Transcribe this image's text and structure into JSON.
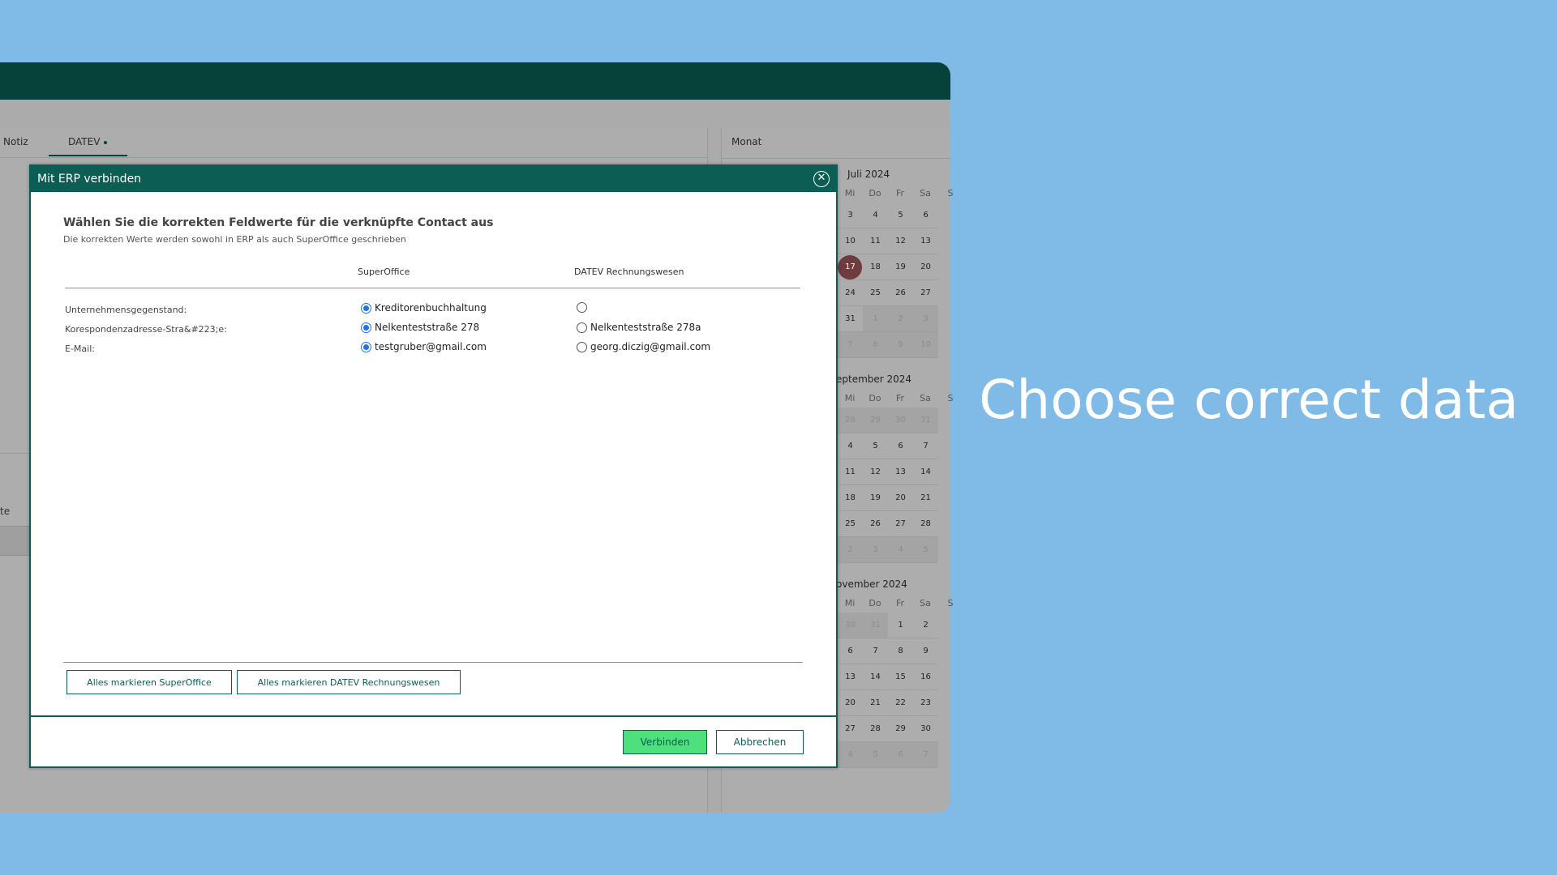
{
  "background": {
    "color": "#7fbbe6"
  },
  "caption": "Choose correct data",
  "tabs": [
    {
      "label": "Notiz"
    },
    {
      "label": "DATEV"
    }
  ],
  "left_panel": {
    "partial_text": "te"
  },
  "right_panel": {
    "view_label": "Monat"
  },
  "calendar": {
    "months": [
      {
        "title": "Juli 2024",
        "weekdays": [
          "Mi",
          "Do",
          "Fr",
          "Sa",
          "S"
        ],
        "rows": [
          [
            "3",
            "4",
            "5",
            "6"
          ],
          [
            "10",
            "11",
            "12",
            "13"
          ],
          [
            "17",
            "18",
            "19",
            "20"
          ],
          [
            "24",
            "25",
            "26",
            "27"
          ],
          [
            "31",
            "1",
            "2",
            "3"
          ],
          [
            "7",
            "8",
            "9",
            "10"
          ]
        ],
        "today": "17"
      },
      {
        "title": "eptember 2024",
        "weekdays": [
          "Mi",
          "Do",
          "Fr",
          "Sa",
          "S"
        ],
        "rows": [
          [
            "28",
            "29",
            "30",
            "31"
          ],
          [
            "4",
            "5",
            "6",
            "7"
          ],
          [
            "11",
            "12",
            "13",
            "14"
          ],
          [
            "18",
            "19",
            "20",
            "21"
          ],
          [
            "25",
            "26",
            "27",
            "28"
          ],
          [
            "2",
            "3",
            "4",
            "5"
          ]
        ]
      },
      {
        "title": "ovember 2024",
        "weekdays": [
          "Mi",
          "Do",
          "Fr",
          "Sa",
          "S"
        ],
        "rows": [
          [
            "30",
            "31",
            "1",
            "2"
          ],
          [
            "6",
            "7",
            "8",
            "9"
          ],
          [
            "13",
            "14",
            "15",
            "16"
          ],
          [
            "20",
            "21",
            "22",
            "23"
          ],
          [
            "27",
            "28",
            "29",
            "30"
          ],
          [
            "4",
            "5",
            "6",
            "7"
          ]
        ]
      }
    ]
  },
  "modal": {
    "title": "Mit ERP verbinden",
    "close_icon": "close-icon",
    "heading": "Wählen Sie die korrekten Feldwerte für die verknüpfte Contact aus",
    "subheading": "Die korrekten Werte werden sowohl in ERP als auch SuperOffice geschrieben",
    "columns": {
      "superoffice": "SuperOffice",
      "datev": "DATEV Rechnungswesen"
    },
    "rows": [
      {
        "label": "Unternehmensgegenstand:",
        "superoffice": "Kreditorenbuchhaltung",
        "datev": "",
        "selected": "superoffice"
      },
      {
        "label": "Korespondenzadresse-Stra&#223;e:",
        "superoffice": "Nelkenteststraße 278",
        "datev": "Nelkenteststraße 278a",
        "selected": "superoffice"
      },
      {
        "label": "E-Mail:",
        "superoffice": "testgruber@gmail.com",
        "datev": "georg.diczig@gmail.com",
        "selected": "superoffice"
      }
    ],
    "mark_all_superoffice": "Alles markieren SuperOffice",
    "mark_all_datev": "Alles markieren DATEV Rechnungswesen",
    "connect_button": "Verbinden",
    "cancel_button": "Abbrechen",
    "colors": {
      "primary": "#0c5d53",
      "connect": "#4fe07e",
      "header": "#06423a"
    }
  }
}
